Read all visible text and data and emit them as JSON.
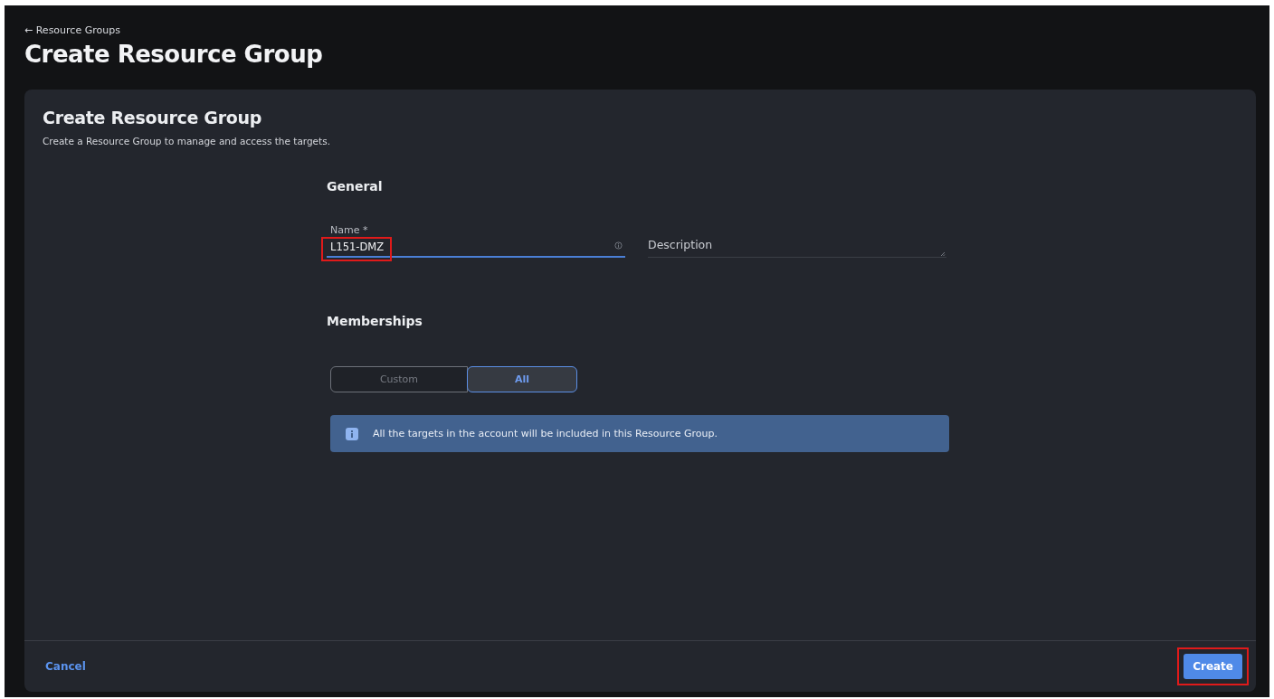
{
  "header": {
    "back_link": "← Resource Groups",
    "title": "Create Resource Group"
  },
  "card": {
    "title": "Create Resource Group",
    "subtitle": "Create a Resource Group to manage and access the targets."
  },
  "general": {
    "heading": "General",
    "name_field": {
      "label": "Name *",
      "value": "L151-DMZ",
      "focused": true,
      "highlighted": true
    },
    "description_field": {
      "placeholder": "Description"
    }
  },
  "memberships": {
    "heading": "Memberships",
    "segments": [
      {
        "label": "Custom",
        "selected": false
      },
      {
        "label": "All",
        "selected": true
      }
    ],
    "info": "All the targets in the account will be included in this Resource Group."
  },
  "footer": {
    "cancel": "Cancel",
    "create": {
      "label": "Create",
      "highlighted": true
    }
  }
}
